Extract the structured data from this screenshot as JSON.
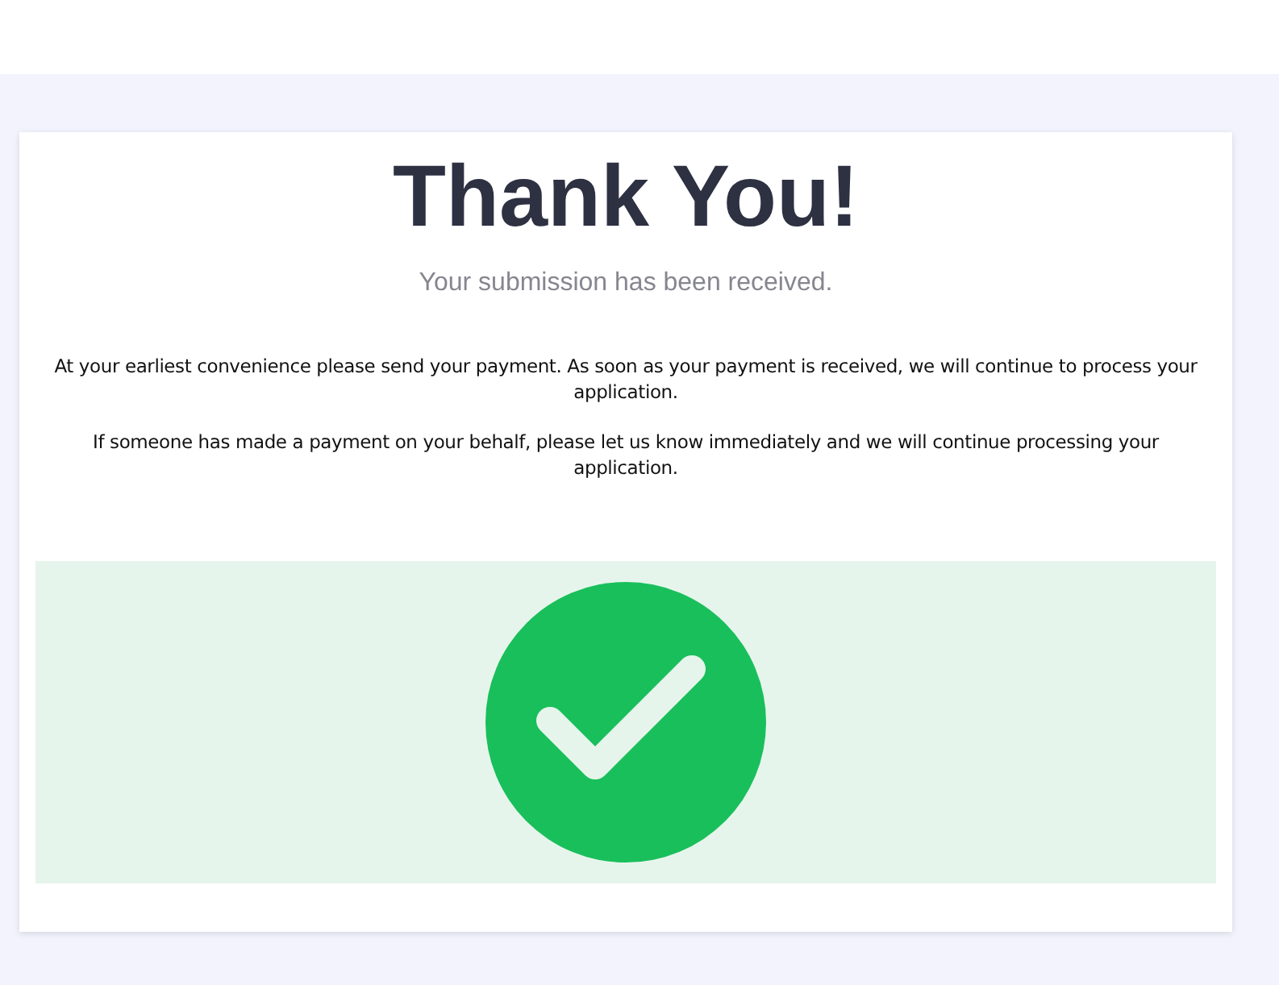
{
  "title": "Thank You!",
  "subtitle": "Your submission has been received.",
  "paragraphs": [
    "At your earliest convenience please send your payment. As soon as your payment is received, we will continue to process your application.",
    "If someone has made a payment on your behalf, please let us know immediately and we will continue processing your application."
  ],
  "confirmation": {
    "kind": "success"
  }
}
